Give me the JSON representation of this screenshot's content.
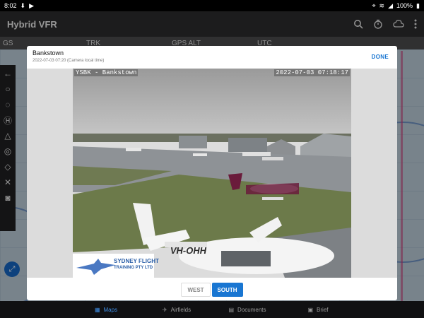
{
  "status": {
    "time": "8:02",
    "battery": "100%"
  },
  "app": {
    "title": "Hybrid VFR"
  },
  "map": {
    "strip": {
      "gs": "GS",
      "trk": "TRK",
      "gps_alt": "GPS ALT",
      "utc": "UTC"
    }
  },
  "modal": {
    "title": "Bankstown",
    "subtitle": "2022-07-03 07:20 (Camera local time)",
    "done_label": "DONE",
    "camera": {
      "name_overlay": "YSBK - Bankstown",
      "timestamp_overlay": "2022-07-03 07:18:17",
      "tail_number": "VH-OHH",
      "logo_line1": "Sydney Flight",
      "logo_line2": "TRAINING PTY LTD"
    },
    "buttons": {
      "west": "WEST",
      "south": "SOUTH"
    },
    "selected_view": "SOUTH"
  },
  "nav": {
    "items": [
      {
        "label": "Maps",
        "active": true,
        "icon": "map-icon"
      },
      {
        "label": "Airfields",
        "active": false,
        "icon": "airplane-icon"
      },
      {
        "label": "Documents",
        "active": false,
        "icon": "documents-icon"
      },
      {
        "label": "Brief",
        "active": false,
        "icon": "briefcase-icon"
      }
    ]
  },
  "colors": {
    "accent": "#1976d2",
    "appbar": "#2b2b2d"
  }
}
